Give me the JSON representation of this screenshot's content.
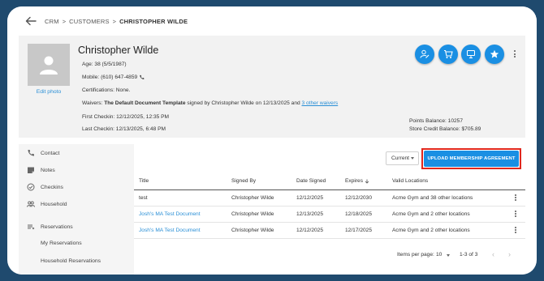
{
  "breadcrumb": {
    "items": [
      "CRM",
      "CUSTOMERS",
      "CHRISTOPHER WILDE"
    ],
    "separator": ">"
  },
  "profile": {
    "edit_photo": "Edit photo",
    "name": "Christopher Wilde",
    "age": "Age: 38 (5/5/1987)",
    "mobile": "Mobile: (610) 647-4859",
    "certifications": "Certifications: None.",
    "waivers_prefix": "Waivers:",
    "waivers_doc": "The Default Document Template",
    "waivers_signed": "signed by Christopher Wilde on 12/13/2025 and",
    "waivers_link": "3 other waivers",
    "first_checkin": "First Checkin: 12/12/2025, 12:35 PM",
    "last_checkin": "Last Checkin: 12/13/2025, 6:48 PM",
    "points_balance": "Points Balance: 10257",
    "store_credit": "Store Credit Balance: $705.89"
  },
  "actions": [
    {
      "name": "edit-person",
      "icon": "person-edit-icon"
    },
    {
      "name": "cart",
      "icon": "cart-icon"
    },
    {
      "name": "pos",
      "icon": "register-icon"
    },
    {
      "name": "favorite",
      "icon": "star-icon"
    }
  ],
  "sidebar": {
    "items": [
      {
        "label": "Contact",
        "icon": "phone-icon"
      },
      {
        "label": "Notes",
        "icon": "note-icon"
      },
      {
        "label": "Checkins",
        "icon": "check-circle-icon"
      },
      {
        "label": "Household",
        "icon": "group-icon"
      },
      {
        "label": "Reservations",
        "icon": "list-icon"
      }
    ],
    "sub_items": [
      "My Reservations",
      "Household Reservations"
    ]
  },
  "main": {
    "filter_value": "Current",
    "upload_button": "UPLOAD MEMBERSHIP AGREEMENT",
    "columns": [
      "Title",
      "Signed By",
      "Date Signed",
      "Expires",
      "Valid Locations"
    ],
    "rows": [
      {
        "title": "test",
        "signed_by": "Christopher Wilde",
        "date_signed": "12/12/2025",
        "expires": "12/12/2030",
        "locations": "Acme Gym and 38 other locations",
        "is_link": false
      },
      {
        "title": "Josh's MA Test Document",
        "signed_by": "Christopher Wilde",
        "date_signed": "12/13/2025",
        "expires": "12/18/2025",
        "locations": "Acme Gym and 2 other locations",
        "is_link": true
      },
      {
        "title": "Josh's MA Test Document",
        "signed_by": "Christopher Wilde",
        "date_signed": "12/12/2025",
        "expires": "12/17/2025",
        "locations": "Acme Gym and 2 other locations",
        "is_link": true
      }
    ],
    "pager": {
      "label": "Items per page:",
      "per_page": "10",
      "range": "1-3 of 3"
    }
  },
  "colors": {
    "accent": "#1a8fe3",
    "link": "#2a8fd6",
    "highlight": "#e0281e",
    "frame": "#1f4a6e"
  }
}
